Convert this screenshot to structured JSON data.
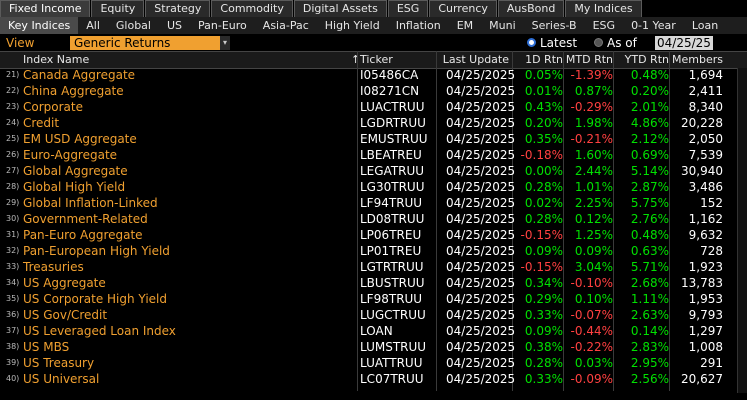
{
  "top_tabs": [
    "Fixed Income",
    "Equity",
    "Strategy",
    "Commodity",
    "Digital Assets",
    "ESG",
    "Currency",
    "AusBond",
    "My Indices"
  ],
  "sub_tabs": [
    "Key Indices",
    "All",
    "Global",
    "US",
    "Pan-Euro",
    "Asia-Pac",
    "High Yield",
    "Inflation",
    "EM",
    "Muni",
    "Series-B",
    "ESG",
    "0-1 Year",
    "Loan"
  ],
  "view": {
    "label": "View",
    "selected": "Generic Returns"
  },
  "mode": {
    "latest": "Latest",
    "asof": "As of",
    "date": "04/25/25"
  },
  "headers": {
    "name": "Index Name",
    "ticker": "Ticker",
    "last_update": "Last Update",
    "d1": "1D Rtn",
    "mtd": "MTD Rtn",
    "ytd": "YTD Rtn",
    "members": "Members"
  },
  "colors": {
    "positive": "#00e000",
    "negative": "#ff4040",
    "accent": "#f0a030"
  },
  "rows": [
    {
      "num": "21)",
      "name": "Canada Aggregate",
      "ticker": "I05486CA",
      "date": "04/25/2025",
      "d1": "0.05%",
      "mtd": "-1.39%",
      "ytd": "0.48%",
      "members": "1,694"
    },
    {
      "num": "22)",
      "name": "China Aggregate",
      "ticker": "I08271CN",
      "date": "04/25/2025",
      "d1": "0.01%",
      "mtd": "0.87%",
      "ytd": "0.20%",
      "members": "2,411"
    },
    {
      "num": "23)",
      "name": "Corporate",
      "ticker": "LUACTRUU",
      "date": "04/25/2025",
      "d1": "0.43%",
      "mtd": "-0.29%",
      "ytd": "2.01%",
      "members": "8,340"
    },
    {
      "num": "24)",
      "name": "Credit",
      "ticker": "LGDRTRUU",
      "date": "04/25/2025",
      "d1": "0.20%",
      "mtd": "1.98%",
      "ytd": "4.86%",
      "members": "20,228"
    },
    {
      "num": "25)",
      "name": "EM USD Aggregate",
      "ticker": "EMUSTRUU",
      "date": "04/25/2025",
      "d1": "0.35%",
      "mtd": "-0.21%",
      "ytd": "2.12%",
      "members": "2,050"
    },
    {
      "num": "26)",
      "name": "Euro-Aggregate",
      "ticker": "LBEATREU",
      "date": "04/25/2025",
      "d1": "-0.18%",
      "mtd": "1.60%",
      "ytd": "0.69%",
      "members": "7,539"
    },
    {
      "num": "27)",
      "name": "Global Aggregate",
      "ticker": "LEGATRUU",
      "date": "04/25/2025",
      "d1": "0.00%",
      "mtd": "2.44%",
      "ytd": "5.14%",
      "members": "30,940"
    },
    {
      "num": "28)",
      "name": "Global High Yield",
      "ticker": "LG30TRUU",
      "date": "04/25/2025",
      "d1": "0.28%",
      "mtd": "1.01%",
      "ytd": "2.87%",
      "members": "3,486"
    },
    {
      "num": "29)",
      "name": "Global Inflation-Linked",
      "ticker": "LF94TRUU",
      "date": "04/25/2025",
      "d1": "0.02%",
      "mtd": "2.25%",
      "ytd": "5.75%",
      "members": "152"
    },
    {
      "num": "30)",
      "name": "Government-Related",
      "ticker": "LD08TRUU",
      "date": "04/25/2025",
      "d1": "0.28%",
      "mtd": "0.12%",
      "ytd": "2.76%",
      "members": "1,162"
    },
    {
      "num": "31)",
      "name": "Pan-Euro Aggregate",
      "ticker": "LP06TREU",
      "date": "04/25/2025",
      "d1": "-0.15%",
      "mtd": "1.25%",
      "ytd": "0.48%",
      "members": "9,632"
    },
    {
      "num": "32)",
      "name": "Pan-European High Yield",
      "ticker": "LP01TREU",
      "date": "04/25/2025",
      "d1": "0.09%",
      "mtd": "0.09%",
      "ytd": "0.63%",
      "members": "728"
    },
    {
      "num": "33)",
      "name": "Treasuries",
      "ticker": "LGTRTRUU",
      "date": "04/25/2025",
      "d1": "-0.15%",
      "mtd": "3.04%",
      "ytd": "5.71%",
      "members": "1,923"
    },
    {
      "num": "34)",
      "name": "US Aggregate",
      "ticker": "LBUSTRUU",
      "date": "04/25/2025",
      "d1": "0.34%",
      "mtd": "-0.10%",
      "ytd": "2.68%",
      "members": "13,783"
    },
    {
      "num": "35)",
      "name": "US Corporate High Yield",
      "ticker": "LF98TRUU",
      "date": "04/25/2025",
      "d1": "0.29%",
      "mtd": "0.10%",
      "ytd": "1.11%",
      "members": "1,953"
    },
    {
      "num": "36)",
      "name": "US Gov/Credit",
      "ticker": "LUGCTRUU",
      "date": "04/25/2025",
      "d1": "0.33%",
      "mtd": "-0.07%",
      "ytd": "2.63%",
      "members": "9,793"
    },
    {
      "num": "37)",
      "name": "US Leveraged Loan Index",
      "ticker": "LOAN",
      "date": "04/25/2025",
      "d1": "0.09%",
      "mtd": "-0.44%",
      "ytd": "0.14%",
      "members": "1,297"
    },
    {
      "num": "38)",
      "name": "US MBS",
      "ticker": "LUMSTRUU",
      "date": "04/25/2025",
      "d1": "0.38%",
      "mtd": "-0.22%",
      "ytd": "2.83%",
      "members": "1,008"
    },
    {
      "num": "39)",
      "name": "US Treasury",
      "ticker": "LUATTRUU",
      "date": "04/25/2025",
      "d1": "0.28%",
      "mtd": "0.03%",
      "ytd": "2.95%",
      "members": "291"
    },
    {
      "num": "40)",
      "name": "US Universal",
      "ticker": "LC07TRUU",
      "date": "04/25/2025",
      "d1": "0.33%",
      "mtd": "-0.09%",
      "ytd": "2.56%",
      "members": "20,627"
    }
  ]
}
